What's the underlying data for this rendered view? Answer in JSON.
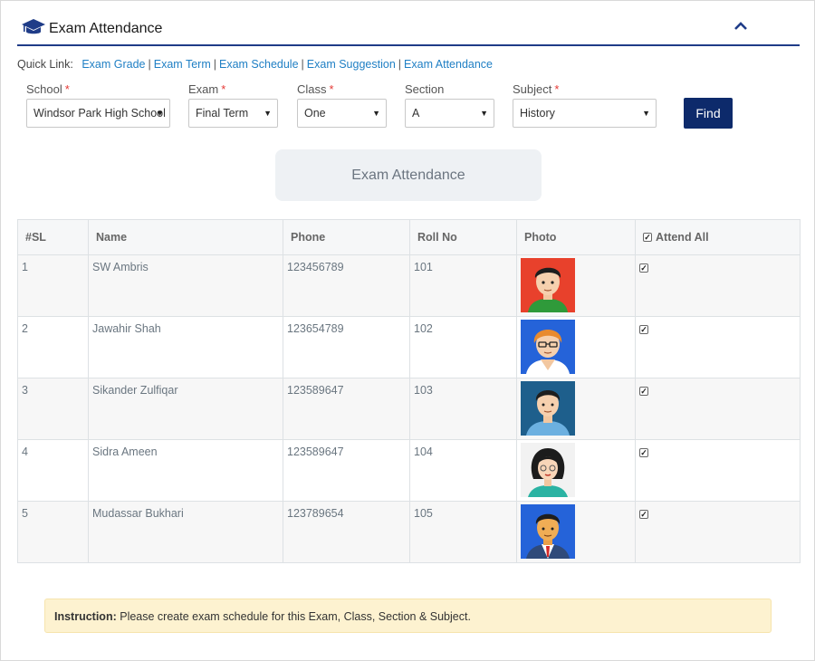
{
  "header": {
    "title": "Exam Attendance",
    "icon": "graduation-cap-icon",
    "collapse_icon": "chevron-up-icon"
  },
  "quick_links": {
    "label": "Quick Link:",
    "items": [
      {
        "label": "Exam Grade"
      },
      {
        "label": "Exam Term"
      },
      {
        "label": "Exam Schedule"
      },
      {
        "label": "Exam Suggestion"
      },
      {
        "label": "Exam Attendance"
      }
    ]
  },
  "filters": {
    "school": {
      "label": "School",
      "required": "*",
      "value": "Windsor Park High School"
    },
    "exam": {
      "label": "Exam",
      "required": "*",
      "value": "Final Term"
    },
    "class": {
      "label": "Class",
      "required": "*",
      "value": "One"
    },
    "section": {
      "label": "Section",
      "value": "A"
    },
    "subject": {
      "label": "Subject",
      "required": "*",
      "value": "History"
    },
    "find_label": "Find"
  },
  "section_button": {
    "label": "Exam Attendance"
  },
  "table": {
    "headers": {
      "sl": "#SL",
      "name": "Name",
      "phone": "Phone",
      "roll": "Roll No",
      "photo": "Photo",
      "attend_all": "Attend All"
    },
    "rows": [
      {
        "sl": "1",
        "name": "SW Ambris",
        "phone": "123456789",
        "roll": "101",
        "attended": true,
        "avatar": "boy-avatar"
      },
      {
        "sl": "2",
        "name": "Jawahir Shah",
        "phone": "123654789",
        "roll": "102",
        "attended": true,
        "avatar": "glasses-avatar"
      },
      {
        "sl": "3",
        "name": "Sikander Zulfiqar",
        "phone": "123589647",
        "roll": "103",
        "attended": true,
        "avatar": "man-avatar"
      },
      {
        "sl": "4",
        "name": "Sidra Ameen",
        "phone": "123589647",
        "roll": "104",
        "attended": true,
        "avatar": "woman-avatar"
      },
      {
        "sl": "5",
        "name": "Mudassar Bukhari",
        "phone": "123789654",
        "roll": "105",
        "attended": true,
        "avatar": "businessman-avatar"
      }
    ]
  },
  "instruction": {
    "label": "Instruction:",
    "text": "Please create exam schedule for this Exam, Class, Section & Subject."
  },
  "colors": {
    "accent": "#1f3c88",
    "link": "#1f7fc4",
    "button": "#0d2a6b",
    "required": "#e53935",
    "notice_bg": "#fdf2d0"
  }
}
